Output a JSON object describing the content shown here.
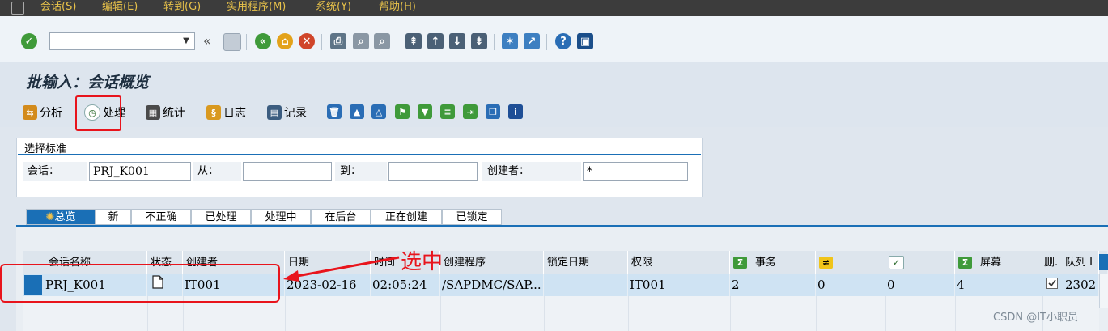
{
  "menu": {
    "items": [
      "会话(S)",
      "编辑(E)",
      "转到(G)",
      "实用程序(M)",
      "系统(Y)",
      "帮助(H)"
    ]
  },
  "toolbar": {
    "command_value": "",
    "back_glyph": "«"
  },
  "page": {
    "title": "批输入：会话概览"
  },
  "app_toolbar": {
    "analyze": "分析",
    "process": "处理",
    "statistics": "统计",
    "log": "日志",
    "record": "记录"
  },
  "selection": {
    "group_title": "选择标准",
    "session_label": "会话：",
    "session_value": "PRJ_K001",
    "from_label": "从：",
    "from_value": "",
    "to_label": "到：",
    "to_value": "",
    "creator_label": "创建者：",
    "creator_value": "*"
  },
  "tabs": [
    "总览",
    "新",
    "不正确",
    "已处理",
    "处理中",
    "在后台",
    "正在创建",
    "已锁定"
  ],
  "table": {
    "columns": [
      "会话名称",
      "状态",
      "创建者",
      "日期",
      "时间",
      "创建程序",
      "锁定日期",
      "权限",
      "事务",
      "",
      "",
      "屏幕",
      "删.",
      "队列 I"
    ],
    "rows": [
      {
        "name": "PRJ_K001",
        "creator": "IT001",
        "date": "2023-02-16",
        "time": "02:05:24",
        "program": "/SAPDMC/SAP...",
        "lock_date": "",
        "auth": "IT001",
        "transactions": "2",
        "col_err": "0",
        "col_ok": "0",
        "screens": "4",
        "queue": "2302"
      }
    ]
  },
  "annotation": {
    "text": "选中"
  },
  "watermark": "CSDN @IT小职员",
  "colors": {
    "accent": "#1a6fb6",
    "annotation": "#e8141c",
    "menu_text": "#e8c24a"
  }
}
